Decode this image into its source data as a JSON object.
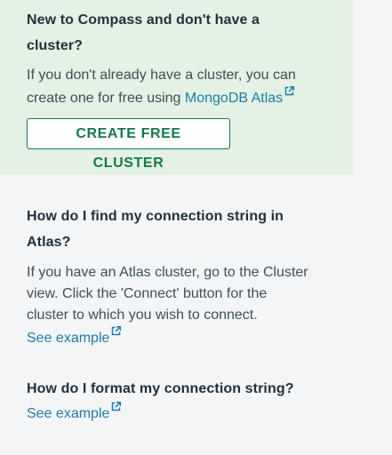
{
  "new_user": {
    "heading_line1": "New to Compass and don't have a",
    "heading_line2": "cluster?",
    "body_line1": "If you don't already have a cluster, you can",
    "body_line2_prefix": "create one for free using ",
    "atlas_link": "MongoDB Atlas",
    "button_label": "CREATE FREE CLUSTER"
  },
  "find_string": {
    "heading_line1": "How do I find my connection string in",
    "heading_line2": "Atlas?",
    "body_line1": "If you have an Atlas cluster, go to the Cluster",
    "body_line2": "view. Click the 'Connect' button for the",
    "body_line3": "cluster to which you wish to connect.",
    "link": "See example"
  },
  "format_string": {
    "heading": "How do I format my connection string?",
    "link": "See example"
  },
  "colors": {
    "panel_background": "#e3f2e4",
    "page_background": "#f4f5f7",
    "link": "#1a7fa8",
    "button_accent": "#13794a"
  },
  "icons": {
    "external_link": "external-link-icon"
  }
}
